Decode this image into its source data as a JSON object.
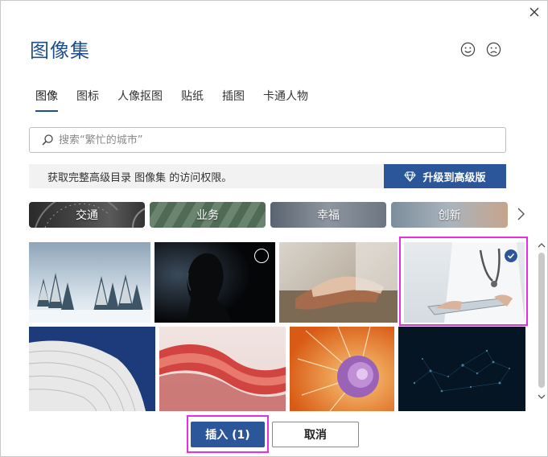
{
  "dialog": {
    "title": "图像集",
    "close_icon": "close-icon",
    "feedback": {
      "positive_icon": "smile-icon",
      "negative_icon": "frown-icon"
    }
  },
  "tabs": [
    {
      "label": "图像",
      "active": true
    },
    {
      "label": "图标",
      "active": false
    },
    {
      "label": "人像抠图",
      "active": false
    },
    {
      "label": "贴纸",
      "active": false
    },
    {
      "label": "插图",
      "active": false
    },
    {
      "label": "卡通人物",
      "active": false
    }
  ],
  "search": {
    "placeholder": "搜索“繁忙的城市”",
    "value": "",
    "icon": "search-icon"
  },
  "banner": {
    "text": "获取完整高级目录 图像集 的访问权限。",
    "upgrade_label": "升级到高级版",
    "upgrade_icon": "diamond-icon"
  },
  "categories": [
    {
      "label": "交通"
    },
    {
      "label": "业务"
    },
    {
      "label": "幸福"
    },
    {
      "label": "创新"
    }
  ],
  "images": [
    {
      "subject": "snowy forest",
      "selected": false
    },
    {
      "subject": "silhouette profile",
      "selected": false
    },
    {
      "subject": "holding hands",
      "selected": false
    },
    {
      "subject": "doctor with tablet",
      "selected": true
    },
    {
      "subject": "white curved architecture",
      "selected": false
    },
    {
      "subject": "red wave ribbons",
      "selected": false
    },
    {
      "subject": "orange nautilus shell",
      "selected": false
    },
    {
      "subject": "dark network particles",
      "selected": false
    }
  ],
  "footer": {
    "insert_label": "插入 (1)",
    "cancel_label": "取消"
  },
  "colors": {
    "accent": "#2b579a",
    "title": "#1f4e8c",
    "highlight": "#e62ee6"
  }
}
